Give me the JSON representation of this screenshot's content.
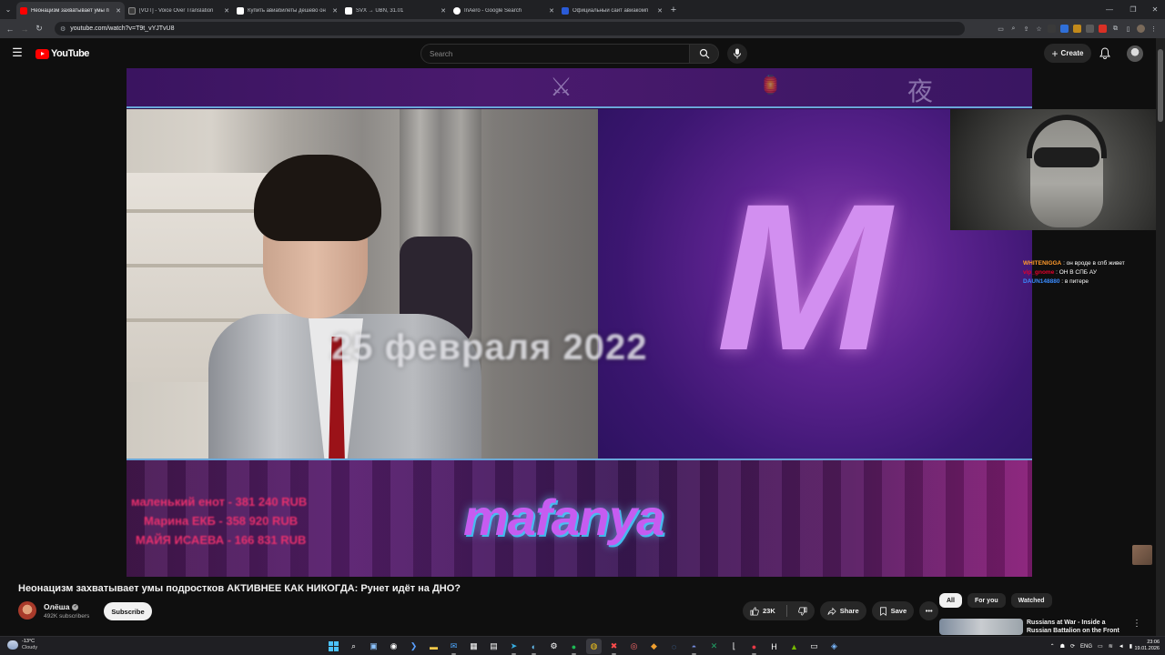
{
  "browser": {
    "tabs": [
      {
        "title": "Неонацизм захватывает умы п",
        "active": true,
        "favicon_color": "#ff0000"
      },
      {
        "title": "[VOT] - Voice Over Translation",
        "active": false,
        "favicon_color": "#3b3b3b"
      },
      {
        "title": "Купить авиабилеты дешево он",
        "active": false,
        "favicon_color": "#ffffff"
      },
      {
        "title": "SVX → UBN, 31.01",
        "active": false,
        "favicon_color": "#ffffff"
      },
      {
        "title": "InAero - Google Search",
        "active": false,
        "favicon_color": "#4285f4"
      },
      {
        "title": "Официальный сайт авиакомп",
        "active": false,
        "favicon_color": "#2a5bd7"
      }
    ],
    "url": "youtube.com/watch?v=T9t_vYJTvU8"
  },
  "youtube": {
    "logo_text": "YouTube",
    "search_placeholder": "Search",
    "create_label": "Create"
  },
  "video": {
    "top_band_glyphs": [
      "⚔",
      "🏮",
      "夜"
    ],
    "date_overlay": "25 февраля 2022",
    "m_letter": "M",
    "donations": [
      "маленький енот - 381 240 RUB",
      "Марина ЕКБ - 358 920 RUB",
      "МАЙЯ ИСАЕВА - 166 831 RUB"
    ],
    "brand": "mafanya",
    "chat": [
      {
        "user": "WHITENIGGA",
        "color": "#ff9a2b",
        "message": ": он вроде в спб живет"
      },
      {
        "user": "vip_gnome",
        "color": "#e4002b",
        "message": ": ОН В СПБ АУ"
      },
      {
        "user": "DAUN148880",
        "color": "#3a8cff",
        "message": ": в питере"
      }
    ]
  },
  "info": {
    "title": "Неонацизм захватывает умы подростков АКТИВНЕЕ КАК НИКОГДА: Рунет идёт на ДНО?",
    "channel": "Олёша",
    "subscribers": "492K subscribers",
    "subscribe_label": "Subscribe",
    "likes": "23K",
    "share_label": "Share",
    "save_label": "Save"
  },
  "sidebar": {
    "chips": [
      "All",
      "For you",
      "Watched"
    ],
    "recommendation_title": "Russians at War - Inside a Russian Battalion on the Front"
  },
  "taskbar": {
    "weather_temp": "-13°C",
    "weather_cond": "Cloudy",
    "language": "ENG",
    "time": "23:06",
    "date": "19.01.2026"
  }
}
